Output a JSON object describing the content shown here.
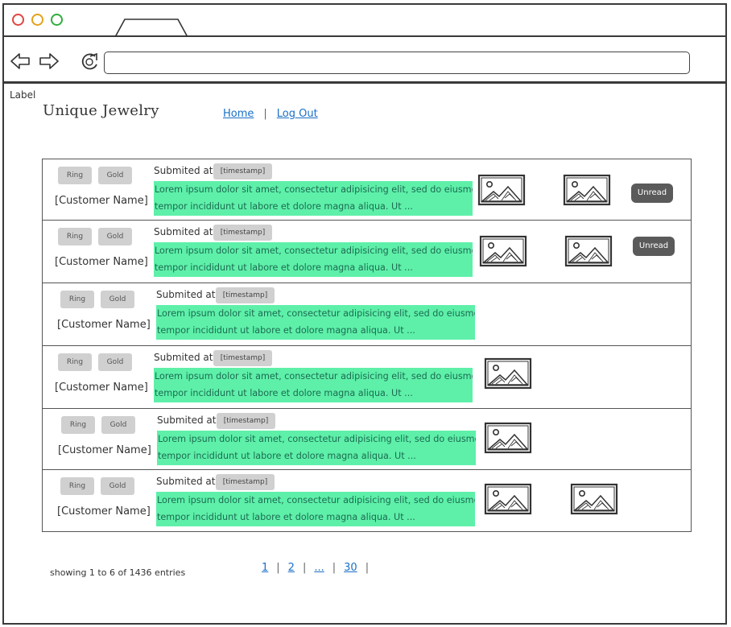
{
  "window": {
    "colors": {
      "close": "#e0463f",
      "minimize": "#e3a21a",
      "maximize": "#2fae3c"
    }
  },
  "navbar": {
    "back_icon": "arrow-left-icon",
    "forward_icon": "arrow-right-icon",
    "reload_icon": "reload-icon",
    "address_value": ""
  },
  "page": {
    "label": "Label",
    "brand": "Unique Jewelry",
    "nav": {
      "home": "Home",
      "separator": "|",
      "logout": "Log Out"
    }
  },
  "rows": [
    {
      "tag1": "Ring",
      "tag2": "Gold",
      "customer": "[Customer Name]",
      "submitted_label": "Submited at",
      "timestamp": "[timestamp]",
      "line1": "Lorem ipsum dolor sit amet, consectetur adipisicing elit, sed do eiusmod",
      "line2": "tempor incididunt ut labore et dolore magna aliqua. Ut ...",
      "images": 2,
      "unread": "Unread"
    },
    {
      "tag1": "Ring",
      "tag2": "Gold",
      "customer": "[Customer Name]",
      "submitted_label": "Submited at",
      "timestamp": "[timestamp]",
      "line1": "Lorem ipsum dolor sit amet, consectetur adipisicing elit, sed do eiusmod",
      "line2": "tempor incididunt ut labore et dolore magna aliqua. Ut ...",
      "images": 2,
      "unread": "Unread"
    },
    {
      "tag1": "Ring",
      "tag2": "Gold",
      "customer": "[Customer Name]",
      "submitted_label": "Submited at",
      "timestamp": "[timestamp]",
      "line1": "Lorem ipsum dolor sit amet, consectetur adipisicing elit, sed do eiusmod",
      "line2": "tempor incididunt ut labore et dolore magna aliqua. Ut ...",
      "images": 0,
      "unread": ""
    },
    {
      "tag1": "Ring",
      "tag2": "Gold",
      "customer": "[Customer Name]",
      "submitted_label": "Submited at",
      "timestamp": "[timestamp]",
      "line1": "Lorem ipsum dolor sit amet, consectetur adipisicing elit, sed do eiusmod",
      "line2": "tempor incididunt ut labore et dolore magna aliqua. Ut ...",
      "images": 1,
      "unread": ""
    },
    {
      "tag1": "Ring",
      "tag2": "Gold",
      "customer": "[Customer Name]",
      "submitted_label": "Submited at",
      "timestamp": "[timestamp]",
      "line1": "Lorem ipsum dolor sit amet, consectetur adipisicing elit, sed do eiusmod",
      "line2": "tempor incididunt ut labore et dolore magna aliqua. Ut ...",
      "images": 1,
      "unread": ""
    },
    {
      "tag1": "Ring",
      "tag2": "Gold",
      "customer": "[Customer Name]",
      "submitted_label": "Submited at",
      "timestamp": "[timestamp]",
      "line1": "Lorem ipsum dolor sit amet, consectetur adipisicing elit, sed do eiusmod",
      "line2": "tempor incididunt ut labore et dolore magna aliqua. Ut ...",
      "images": 2,
      "unread": ""
    }
  ],
  "footer": {
    "showing": "showing 1 to 6 of 1436 entries",
    "pages": [
      "1",
      "2",
      "...",
      "30"
    ],
    "separator": "|"
  }
}
